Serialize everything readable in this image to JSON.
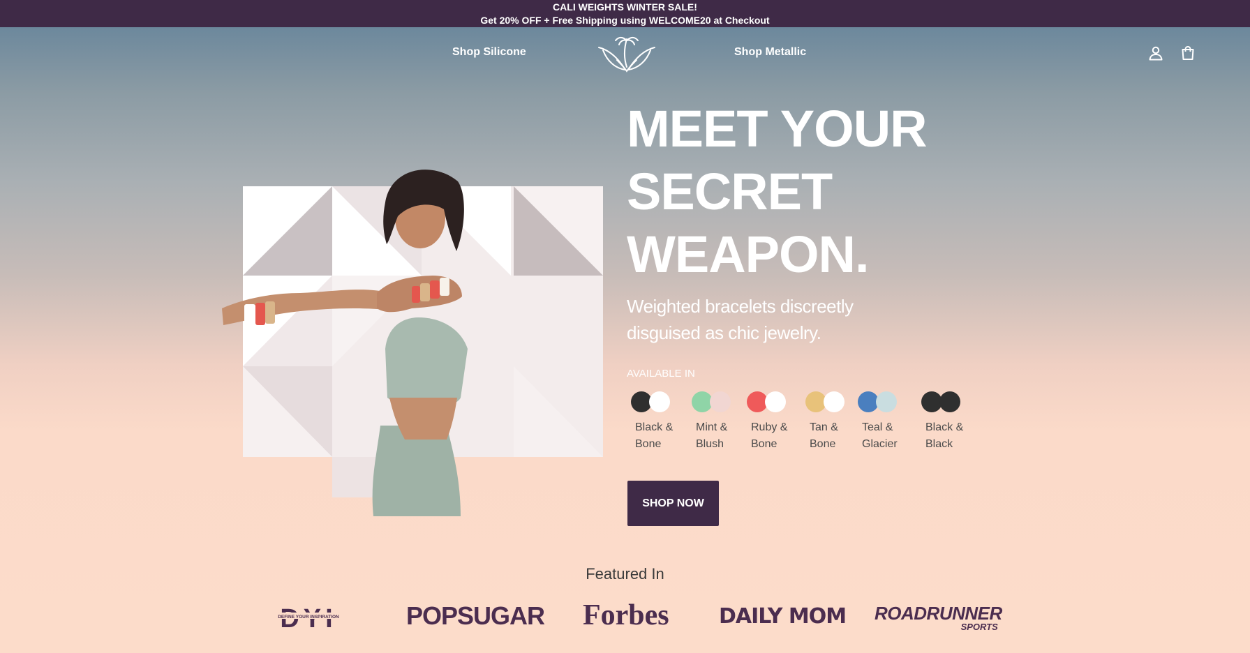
{
  "announcement": {
    "line1": "CALI WEIGHTS WINTER SALE!",
    "line2": "Get 20% OFF + Free Shipping using WELCOME20 at Checkout"
  },
  "header": {
    "nav_left": "Shop Silicone",
    "nav_right": "Shop Metallic",
    "logo_icon": "palm-tree-logo-icon",
    "account_icon": "user-icon",
    "cart_icon": "shopping-bag-icon"
  },
  "hero": {
    "title_lines": [
      "MEET YOUR",
      "SECRET",
      "WEAPON."
    ],
    "subtitle_lines": [
      "Weighted bracelets discreetly",
      "disguised as chic jewelry."
    ],
    "available_label": "AVAILABLE IN",
    "colors": [
      {
        "name1": "Black &",
        "name2": "Bone",
        "color_a": "#2f2f2f",
        "color_b": "#ffffff"
      },
      {
        "name1": "Mint &",
        "name2": "Blush",
        "color_a": "#8fd4a7",
        "color_b": "#f1d6d2"
      },
      {
        "name1": "Ruby &",
        "name2": "Bone",
        "color_a": "#ef5a5a",
        "color_b": "#ffffff"
      },
      {
        "name1": "Tan &",
        "name2": "Bone",
        "color_a": "#e8c27a",
        "color_b": "#ffffff"
      },
      {
        "name1": "Teal &",
        "name2": "Glacier",
        "color_a": "#4a7fbf",
        "color_b": "#c9dde0"
      },
      {
        "name1": "Black &",
        "name2": "Black",
        "color_a": "#2f2f2f",
        "color_b": "#2f2f2f"
      }
    ],
    "cta": "SHOP NOW",
    "model_image": "woman-wearing-weighted-bracelets"
  },
  "featured": {
    "title": "Featured In",
    "logos": {
      "dyi_main": "DYI",
      "dyi_tagline": "DEFINE YOUR INSPIRATION",
      "popsugar": "POPSUGAR",
      "forbes": "Forbes",
      "dailymom": "DAILY MOM",
      "roadrunner_main": "ROADRUNNER",
      "roadrunner_sub": "SPORTS"
    }
  },
  "colors": {
    "brand_purple": "#3f2a47",
    "peach": "#fcdcca"
  }
}
